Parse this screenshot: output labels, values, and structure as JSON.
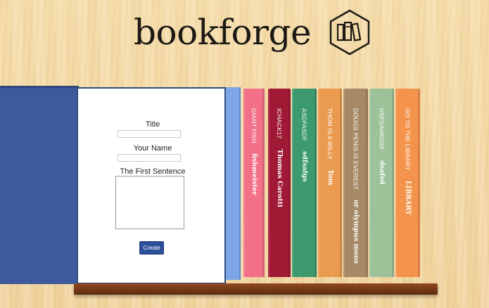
{
  "header": {
    "brand": "bookforge",
    "logo_icon": "hexagon-books-logo-icon"
  },
  "form": {
    "title_label": "Title",
    "title_value": "",
    "name_label": "Your Name",
    "name_value": "",
    "sentence_label": "The First Sentence",
    "sentence_value": "",
    "create_label": "Create"
  },
  "books": [
    {
      "title": "GIANT FISH",
      "author": "fishmeister",
      "color": "#f27088"
    },
    {
      "title": "ICHACK17",
      "author": "Thomas Carotti",
      "color": "#a11a35"
    },
    {
      "title": "ASDFASDF",
      "author": "sdfsafgs",
      "color": "#3d9a6f"
    },
    {
      "title": "THOM IS A WILLY",
      "author": "Tom",
      "color": "#ea9b4f"
    },
    {
      "title": "DOUGS PENIS IS EVEREST",
      "author": "or olympus mons",
      "color": "#a68a66"
    },
    {
      "title": "HSFDAHKDSF",
      "author": "dsafsd",
      "color": "#9dc29a"
    },
    {
      "title": "GO TO THE LIBRARY",
      "author": "LIBRARY",
      "color": "#f4944c"
    }
  ],
  "colors": {
    "cover": "#3e5a9c",
    "page_edge": "#7ea6e6",
    "shelf": "#7a3c18",
    "button": "#2d4f9a"
  }
}
